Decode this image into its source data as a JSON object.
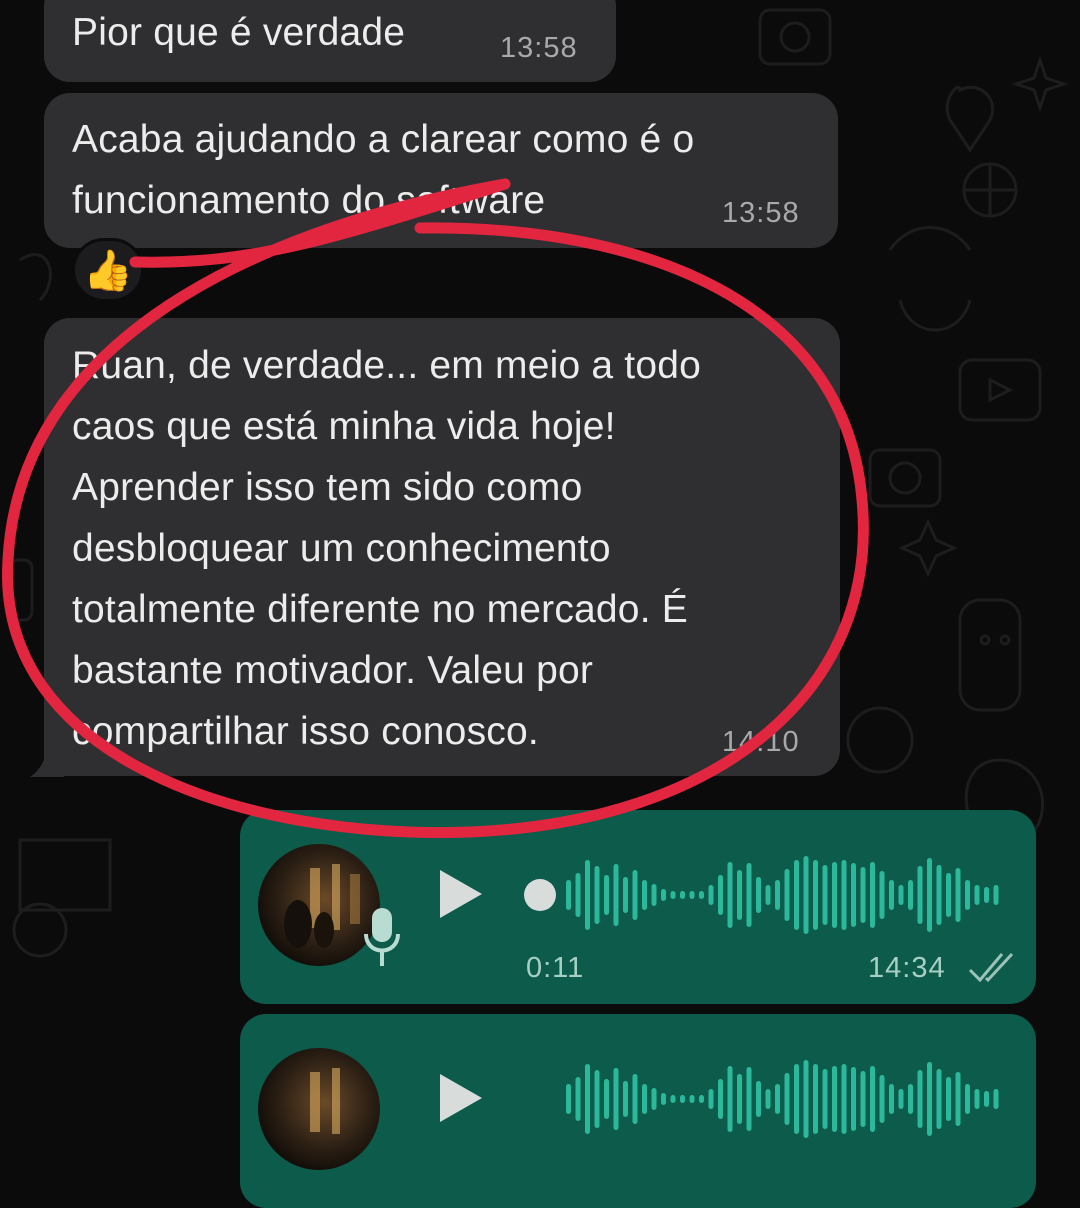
{
  "messages": [
    {
      "text": "Pior que é verdade",
      "time": "13:58"
    },
    {
      "text": "Acaba ajudando a clarear como é o\nfuncionamento do software",
      "time": "13:58",
      "reaction": "👍"
    },
    {
      "text": "Ruan, de verdade... em meio a todo\ncaos que está minha vida hoje!\nAprender isso tem sido como\ndesbloquear um conhecimento\ntotalmente diferente no mercado. É\nbastante motivador. Valeu por\ncompartilhar isso conosco.",
      "time": "14:10"
    }
  ],
  "voice_messages": [
    {
      "duration": "0:11",
      "time": "14:34",
      "status_icon": "double-check-icon"
    },
    {
      "duration": "",
      "time": ""
    }
  ],
  "colors": {
    "incoming_bubble": "#2f2f31",
    "outgoing_bubble": "#0c5b4b",
    "annotation_red": "#e3263f"
  }
}
